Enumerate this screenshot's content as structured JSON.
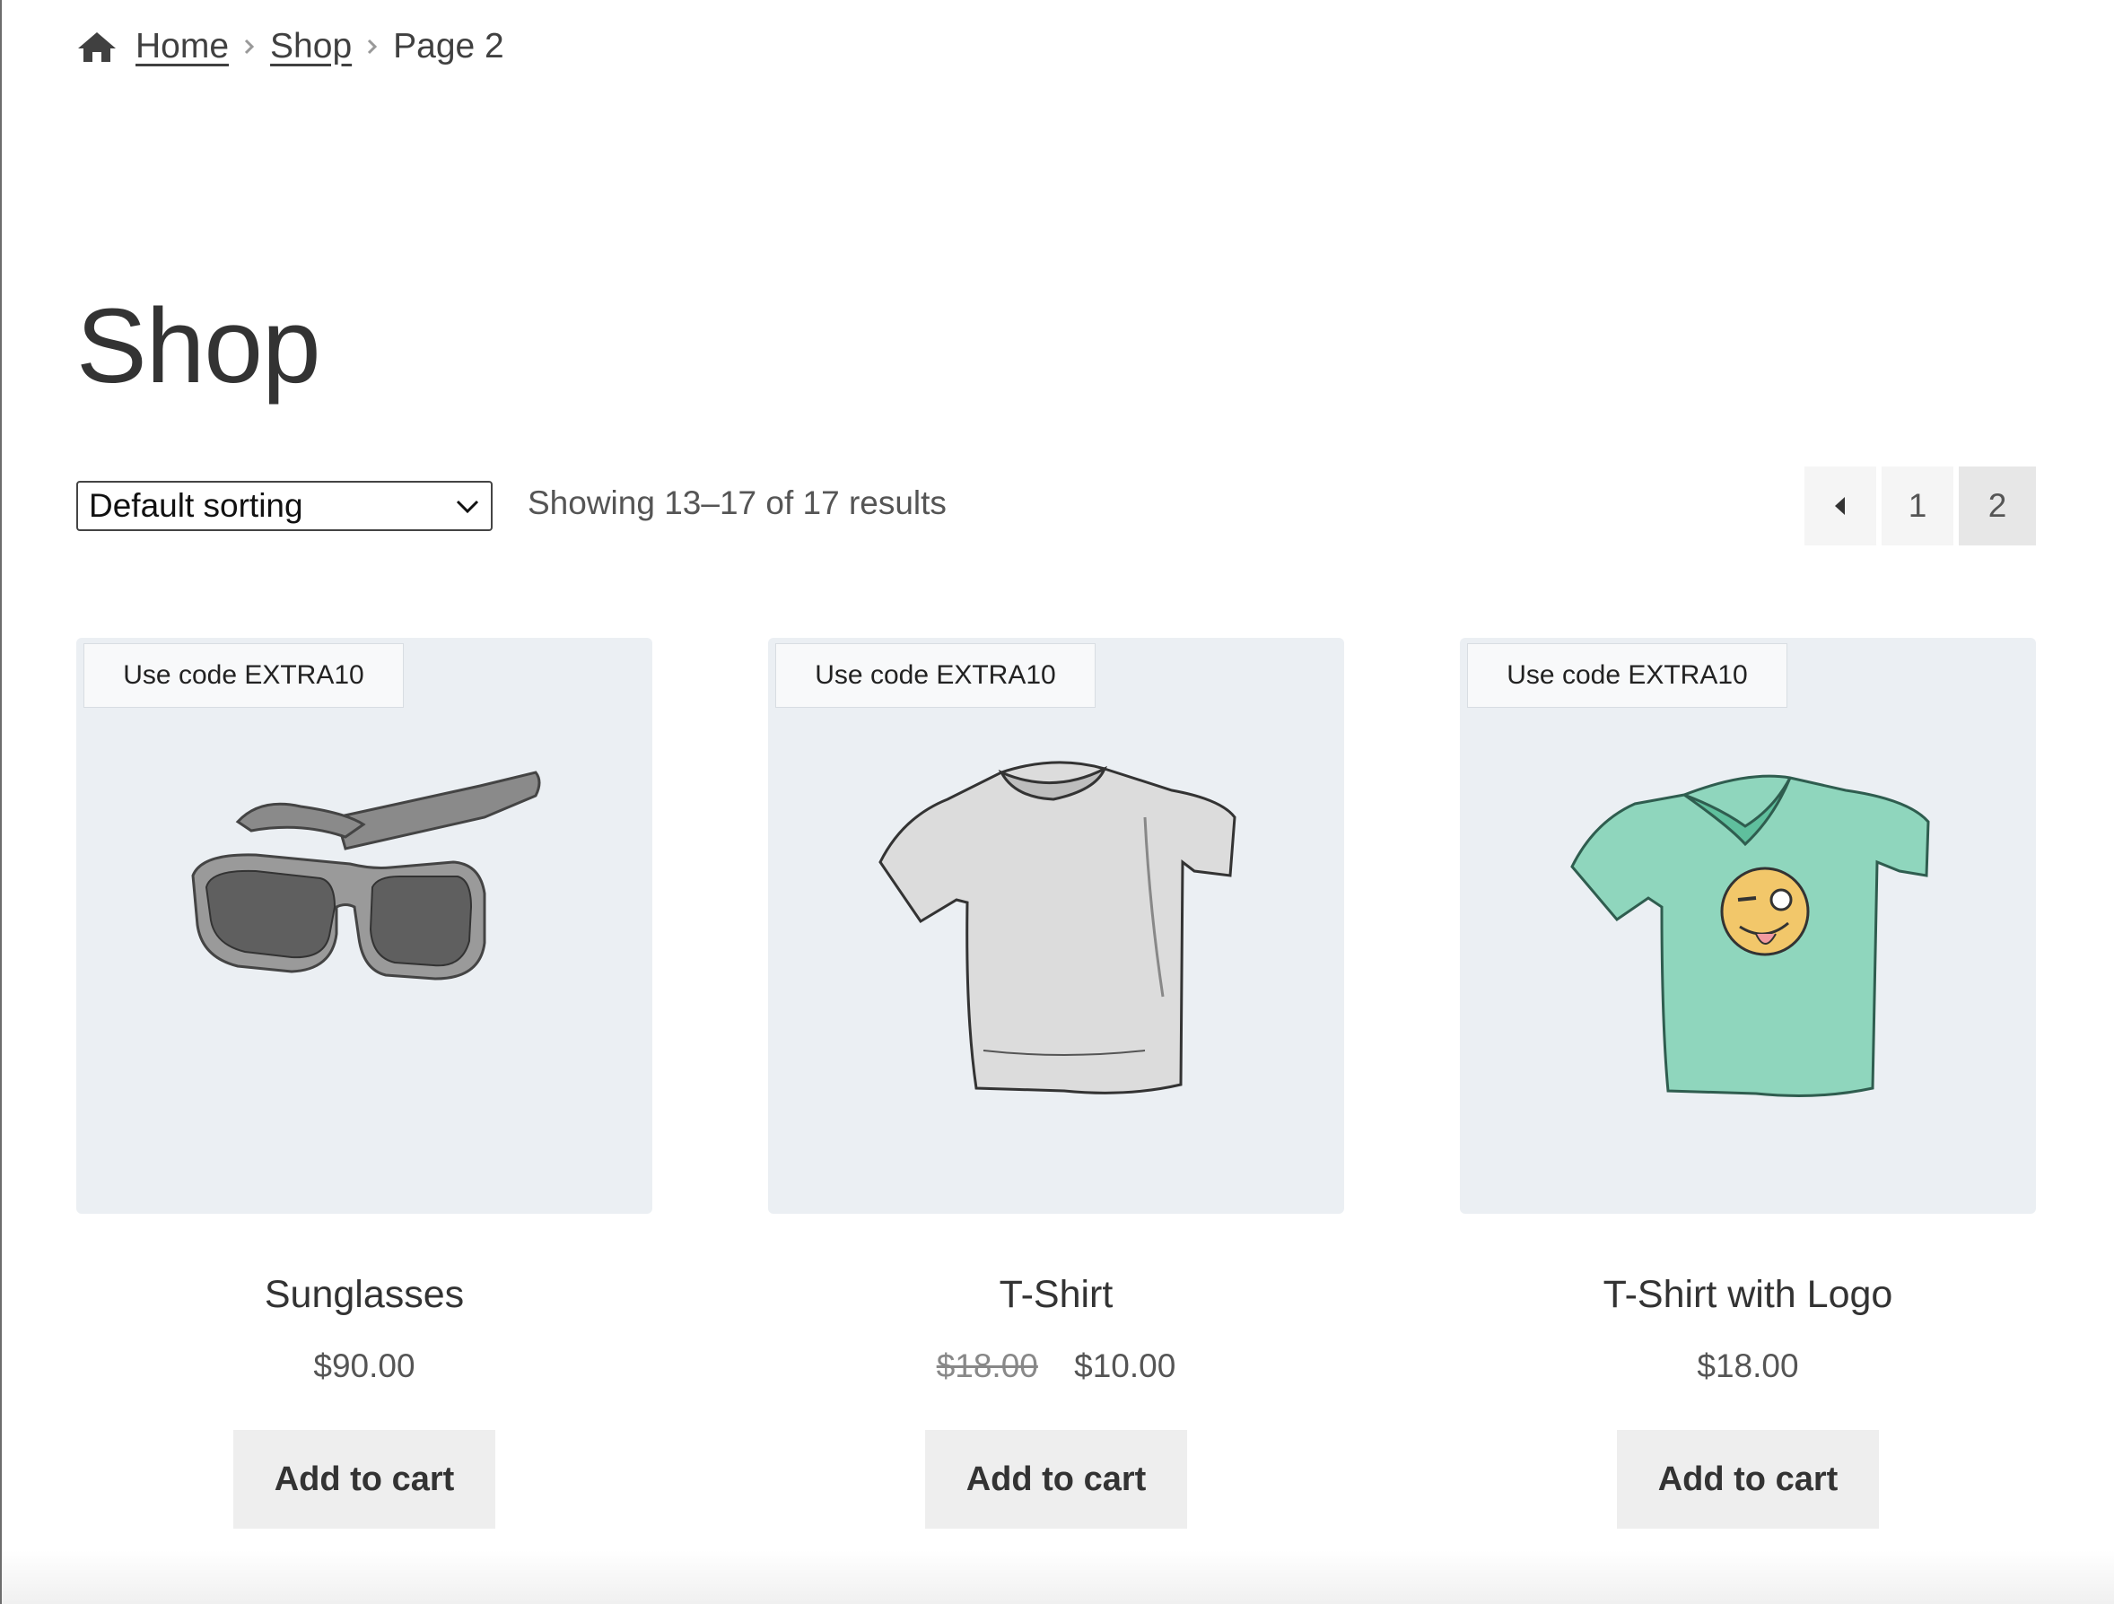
{
  "breadcrumb": {
    "home": "Home",
    "shop": "Shop",
    "current": "Page 2"
  },
  "page_title": "Shop",
  "toolbar": {
    "sort_selected": "Default sorting",
    "result_count": "Showing 13–17 of 17 results"
  },
  "pagination": {
    "pages": [
      "1",
      "2"
    ],
    "current": "2"
  },
  "products": [
    {
      "badge": "Use code EXTRA10",
      "name": "Sunglasses",
      "price": "$90.00",
      "cart_label": "Add to cart",
      "image_icon": "sunglasses-image"
    },
    {
      "badge": "Use code EXTRA10",
      "name": "T-Shirt",
      "regular_price": "$18.00",
      "price": "$10.00",
      "cart_label": "Add to cart",
      "image_icon": "tshirt-image"
    },
    {
      "badge": "Use code EXTRA10",
      "name": "T-Shirt with Logo",
      "price": "$18.00",
      "cart_label": "Add to cart",
      "image_icon": "tshirt-logo-image"
    }
  ],
  "colors": {
    "image_bg": "#ebeff3",
    "tshirt_green": "#8fd6bd",
    "button_bg": "#eeeeee"
  }
}
